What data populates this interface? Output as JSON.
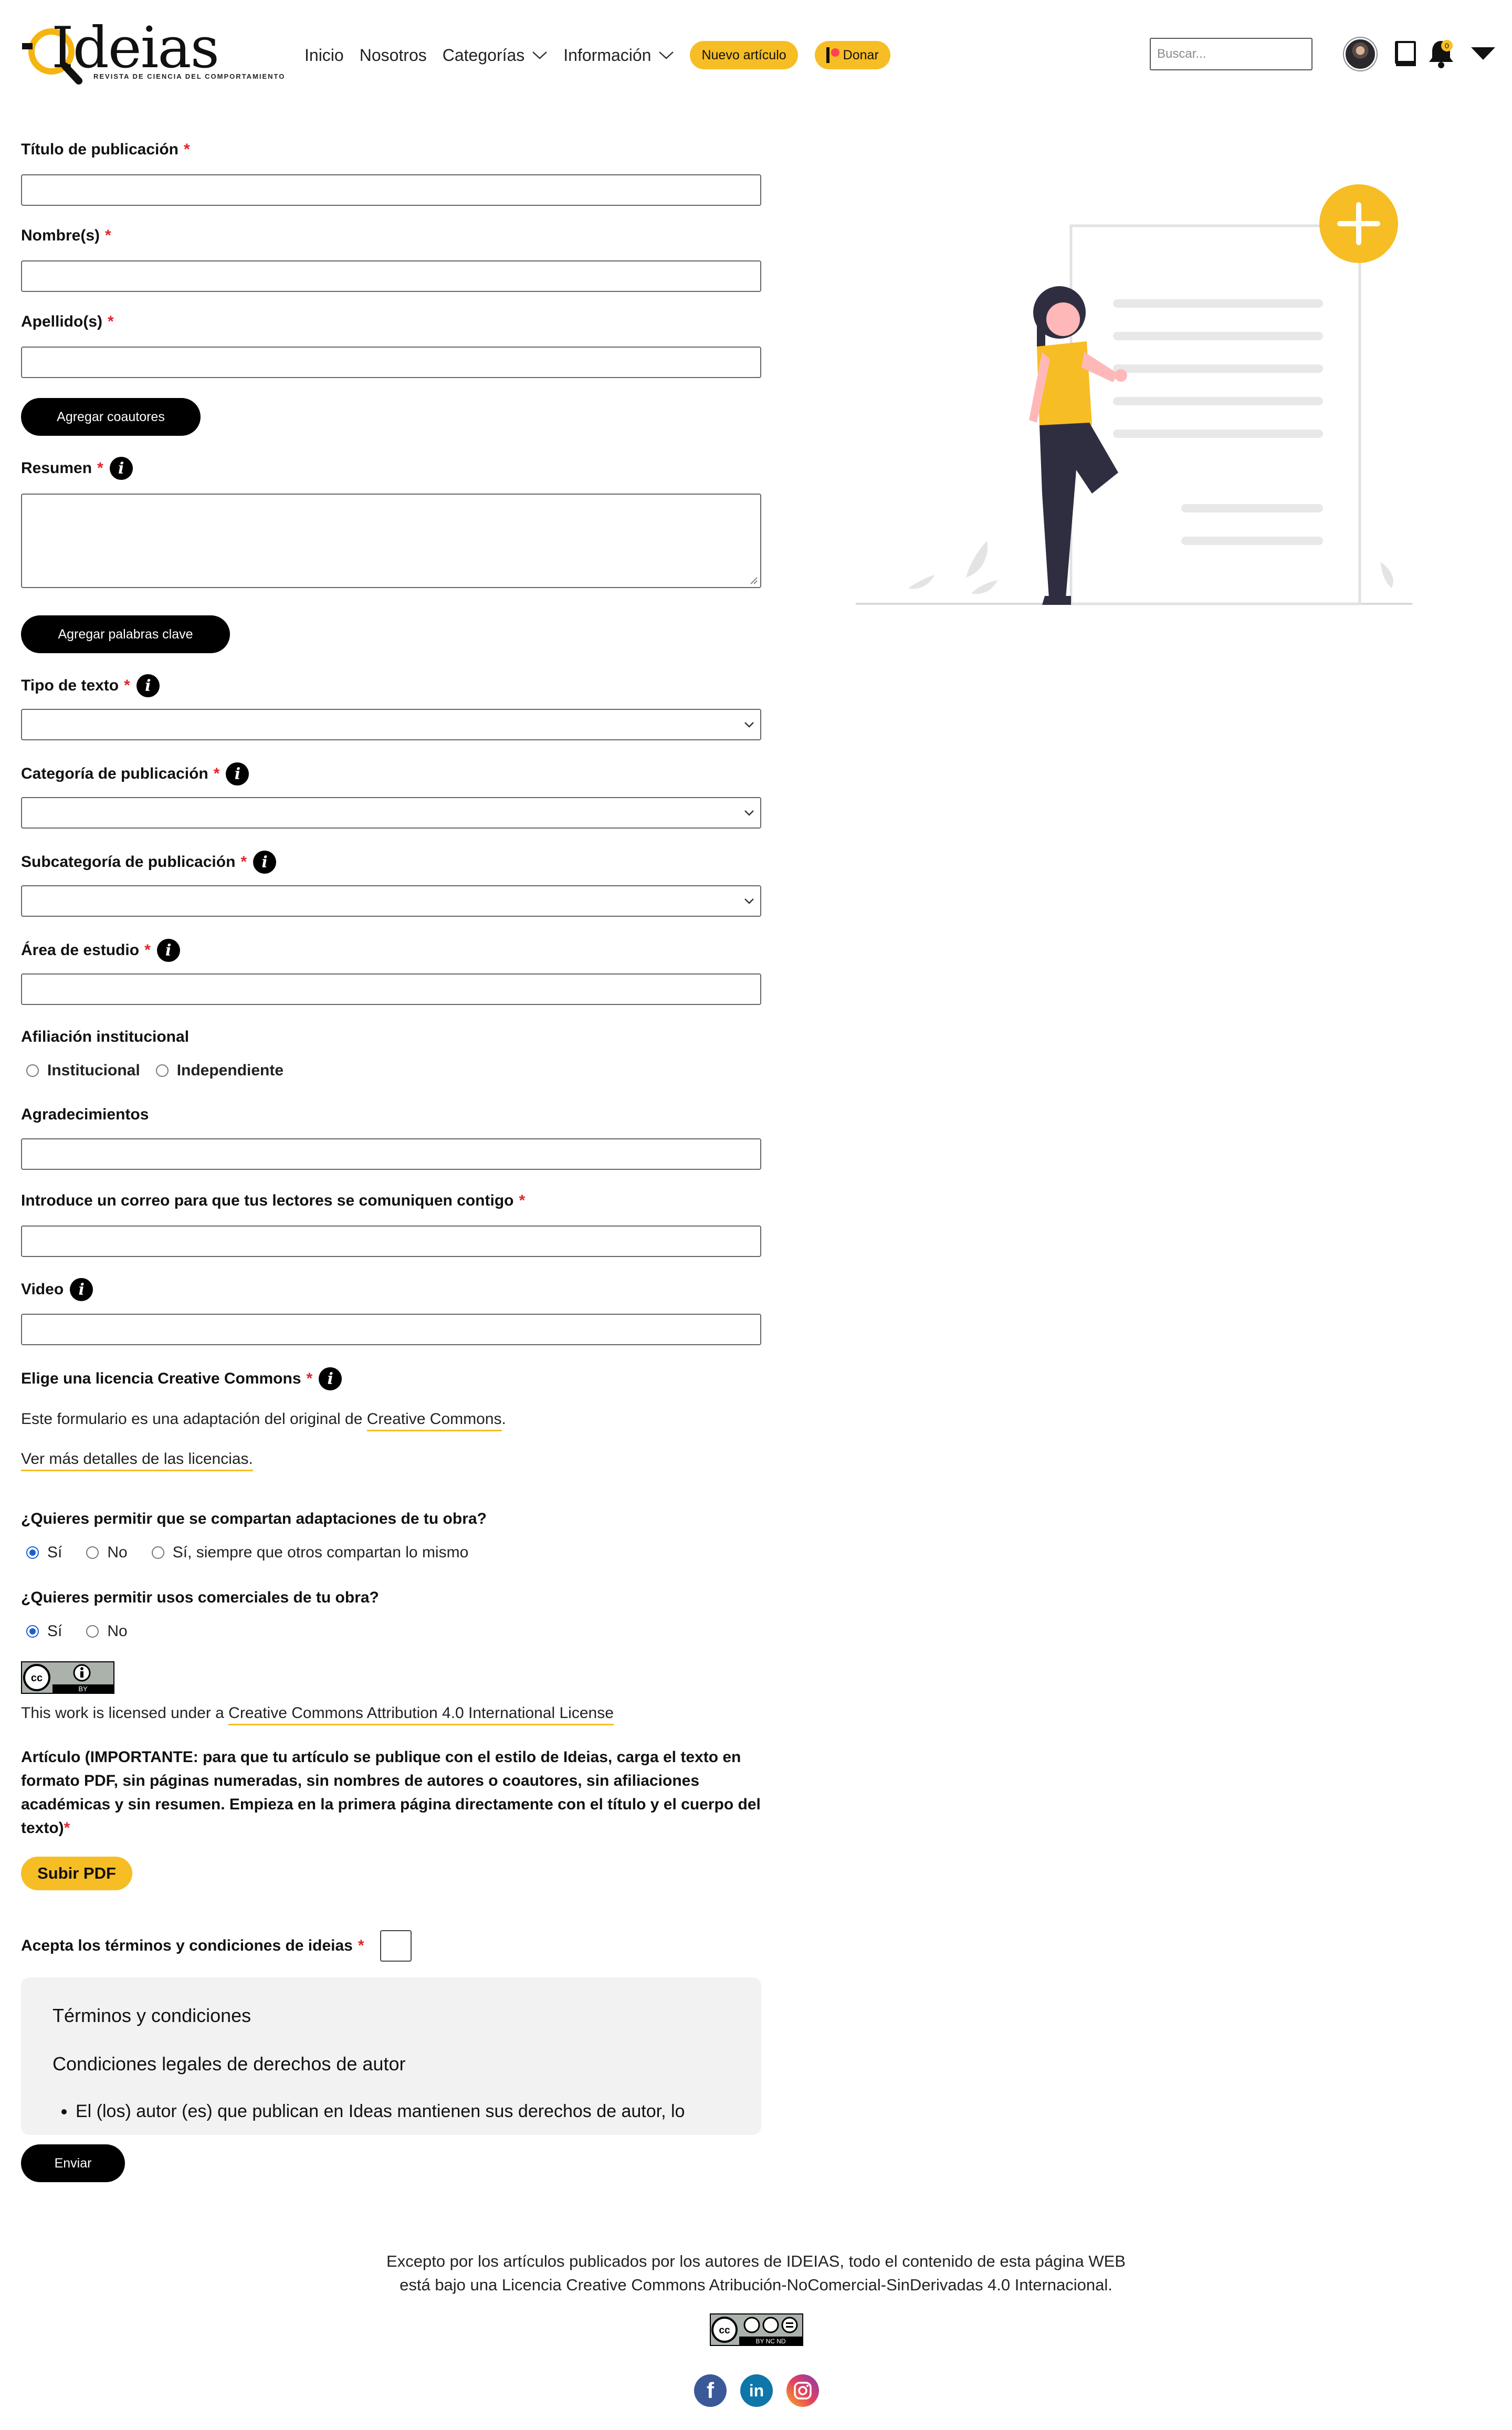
{
  "header": {
    "logo_text": "Ideias",
    "logo_tagline": "REVISTA DE CIENCIA DEL COMPORTAMIENTO",
    "nav": {
      "inicio": "Inicio",
      "nosotros": "Nosotros",
      "categorias": "Categorías",
      "informacion": "Información",
      "nuevo_articulo": "Nuevo artículo",
      "donar": "Donar"
    },
    "search_placeholder": "Buscar...",
    "notification_count": "0",
    "accent_color": "#f7bd24"
  },
  "form": {
    "titulo_label": "Título de publicación",
    "nombres_label": "Nombre(s)",
    "apellidos_label": "Apellido(s)",
    "agregar_coautores": "Agregar coautores",
    "resumen_label": "Resumen",
    "agregar_palabras_clave": "Agregar palabras clave",
    "tipo_texto_label": "Tipo de texto",
    "categoria_label": "Categoría de publicación",
    "subcategoria_label": "Subcategoría de publicación",
    "area_label": "Área de estudio",
    "afiliacion_label": "Afiliación institucional",
    "afiliacion_options": [
      "Institucional",
      "Independiente"
    ],
    "agradecimientos_label": "Agradecimientos",
    "correo_label": "Introduce un correo para que tus lectores se comuniquen contigo",
    "video_label": "Video",
    "licencia_label": "Elige una licencia Creative Commons",
    "adaptacion_prefix": "Este formulario es una adaptación del original de ",
    "adaptacion_link": "Creative Commons",
    "adaptacion_suffix": ".",
    "ver_mas_link": "Ver más detalles de las licencias.",
    "q1_label": "¿Quieres permitir que se compartan adaptaciones de tu obra?",
    "q1_options": [
      "Sí",
      "No",
      "Sí, siempre que otros compartan lo mismo"
    ],
    "q1_selected": "Sí",
    "q2_label": "¿Quieres permitir usos comerciales de tu obra?",
    "q2_options": [
      "Sí",
      "No"
    ],
    "q2_selected": "Sí",
    "cc_badge_text": "BY",
    "license_prefix": "This work is licensed under a ",
    "license_link": "Creative Commons Attribution 4.0 International License",
    "articulo_label": "Artículo (IMPORTANTE: para que tu artículo se publique con el estilo de Ideias, carga el texto en formato PDF, sin páginas numeradas, sin nombres de autores o coautores, sin afiliaciones académicas y sin resumen. Empieza en la primera página directamente con el título y el cuerpo del texto)",
    "subir_pdf": "Subir PDF",
    "acepta_label": "Acepta los términos y condiciones de ideias",
    "enviar": "Enviar",
    "required_mark": "*"
  },
  "terms": {
    "title": "Términos y condiciones",
    "subtitle": "Condiciones legales de derechos de autor",
    "item1": "El (los) autor (es) que publican en Ideas mantienen sus derechos de autor, lo"
  },
  "footer": {
    "line1": "Excepto por los artículos publicados por los autores de IDEIAS, todo el contenido de esta página WEB",
    "line2": "está bajo una Licencia Creative Commons Atribución-NoComercial-SinDerivadas 4.0 Internacional.",
    "cc_badge_text": "BY NC ND",
    "social": [
      "facebook",
      "linkedin",
      "instagram"
    ]
  }
}
